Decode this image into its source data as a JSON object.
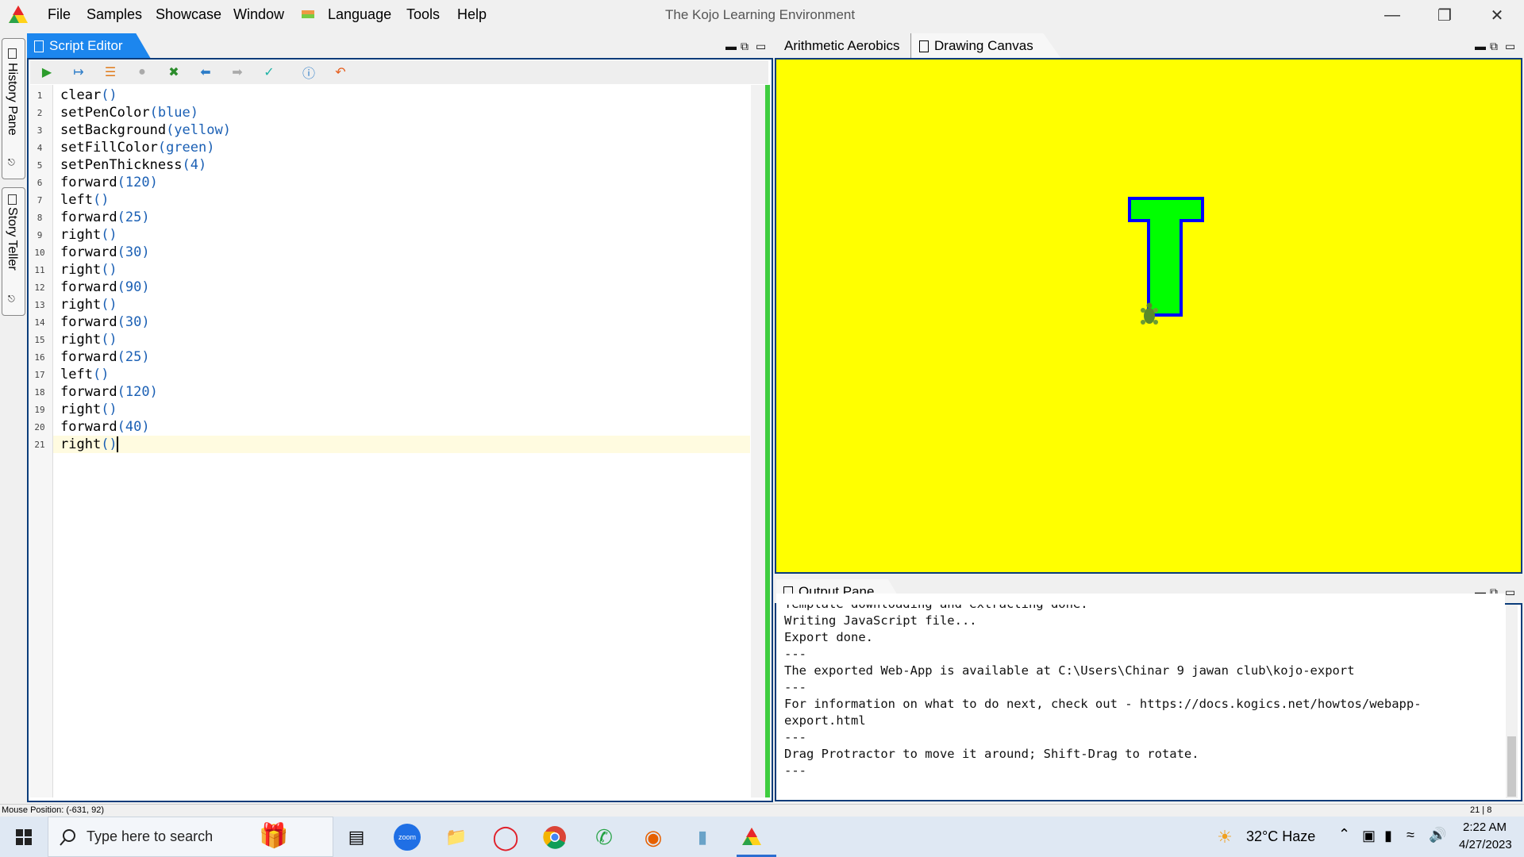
{
  "title_bar": {
    "menu": [
      "File",
      "Samples",
      "Showcase",
      "Window",
      "Language",
      "Tools",
      "Help"
    ],
    "window_title": "The Kojo Learning Environment"
  },
  "side_tabs": [
    "History Pane",
    "Story Teller"
  ],
  "script_editor": {
    "tab_label": "Script Editor",
    "lines": [
      {
        "fn": "clear",
        "args": "()"
      },
      {
        "fn": "setPenColor",
        "args": "(blue)"
      },
      {
        "fn": "setBackground",
        "args": "(yellow)"
      },
      {
        "fn": "setFillColor",
        "args": "(green)"
      },
      {
        "fn": "setPenThickness",
        "args": "(4)"
      },
      {
        "fn": "forward",
        "args": "(120)"
      },
      {
        "fn": "left",
        "args": "()"
      },
      {
        "fn": "forward",
        "args": "(25)"
      },
      {
        "fn": "right",
        "args": "()"
      },
      {
        "fn": "forward",
        "args": "(30)"
      },
      {
        "fn": "right",
        "args": "()"
      },
      {
        "fn": "forward",
        "args": "(90)"
      },
      {
        "fn": "right",
        "args": "()"
      },
      {
        "fn": "forward",
        "args": "(30)"
      },
      {
        "fn": "right",
        "args": "()"
      },
      {
        "fn": "forward",
        "args": "(25)"
      },
      {
        "fn": "left",
        "args": "()"
      },
      {
        "fn": "forward",
        "args": "(120)"
      },
      {
        "fn": "right",
        "args": "()"
      },
      {
        "fn": "forward",
        "args": "(40)"
      },
      {
        "fn": "right",
        "args": "()"
      }
    ]
  },
  "canvas_tabs": {
    "tab1": "Arithmetic Aerobics",
    "tab2": "Drawing Canvas",
    "background_color": "#ffff00",
    "shape_fill": "#00ff00",
    "shape_stroke": "#0000ff"
  },
  "output_pane": {
    "tab_label": "Output Pane",
    "lines": [
      "Template downloading and extracting done.",
      "Writing JavaScript file...",
      "Export done.",
      "---",
      "The exported Web-App is available at C:\\Users\\Chinar 9 jawan club\\kojo-export",
      "---",
      "For information on what to do next, check out - https://docs.kogics.net/howtos/webapp-",
      "export.html",
      "---",
      "Drag Protractor to move it around; Shift-Drag to rotate.",
      "---"
    ]
  },
  "status_bar": {
    "mouse_position": "Mouse Position: (-631, 92)",
    "cursor_pos": "21 | 8"
  },
  "taskbar": {
    "search_placeholder": "Type here to search",
    "weather": "32°C  Haze",
    "time": "2:22 AM",
    "date": "4/27/2023"
  }
}
